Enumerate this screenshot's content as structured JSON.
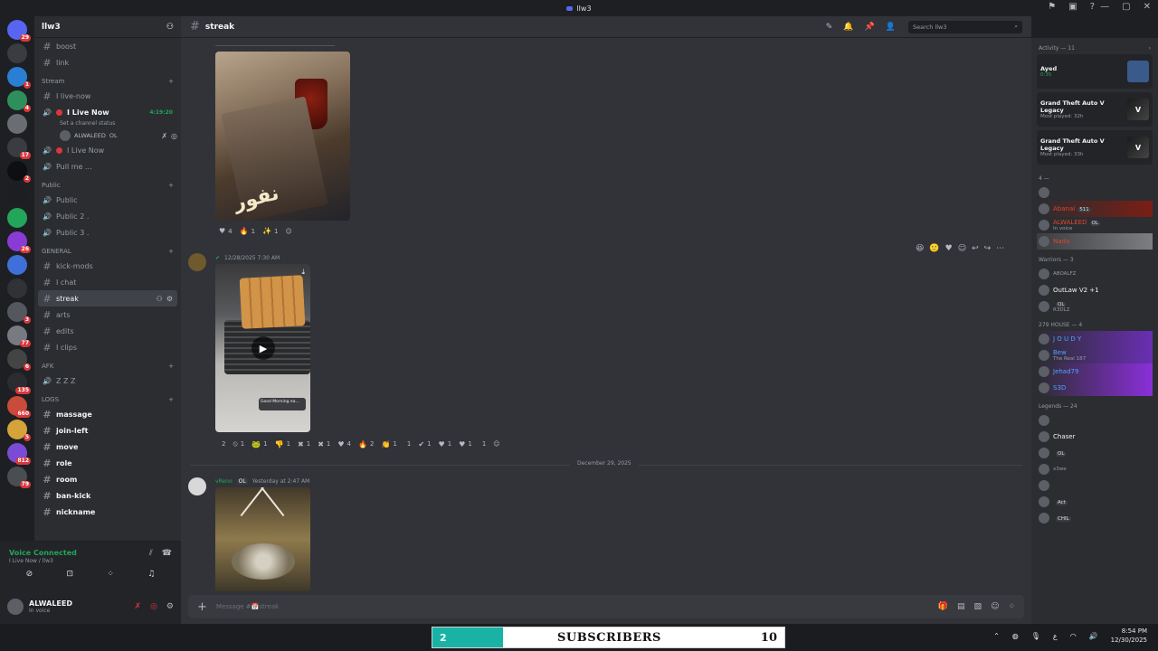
{
  "window": {
    "title": "llw3"
  },
  "guilds": [
    {
      "badge": "29"
    },
    {
      "badge": ""
    },
    {
      "badge": "1"
    },
    {
      "badge": "4"
    },
    {
      "badge": ""
    },
    {
      "badge": "17"
    },
    {
      "badge": "2"
    },
    {
      "badge": ""
    },
    {
      "badge": ""
    },
    {
      "badge": "26"
    },
    {
      "badge": ""
    },
    {
      "badge": ""
    },
    {
      "badge": "3"
    },
    {
      "badge": "77"
    },
    {
      "badge": "6"
    },
    {
      "badge": "135"
    },
    {
      "badge": "660"
    },
    {
      "badge": "5"
    },
    {
      "badge": "812"
    },
    {
      "badge": "79"
    }
  ],
  "server": {
    "name": "llw3"
  },
  "channels": {
    "top": [
      {
        "name": "boost"
      },
      {
        "name": "link"
      }
    ],
    "stream_cat": "Stream",
    "stream": {
      "live_now_text": "I live-now",
      "live_voice": "I Live Now",
      "live_time": "4:19:20",
      "status_hint": "Set a channel status",
      "voice_user": "ALWALEED",
      "voice_user_tag": "OL",
      "live_voice2": "I Live Now",
      "pull_me": "Pull me ..."
    },
    "public_cat": "Public",
    "public": [
      "Public",
      "Public 2 .",
      "Public 3 ."
    ],
    "general_cat": "GENERAL",
    "general": [
      {
        "name": "kick-mods"
      },
      {
        "name": "I chat"
      },
      {
        "name": "streak"
      },
      {
        "name": "arts"
      },
      {
        "name": "edits"
      },
      {
        "name": "I clips"
      }
    ],
    "afk_cat": "AFK",
    "afk": "Z Z Z",
    "logs_cat": "LOGS",
    "logs": [
      "massage",
      "join-left",
      "move",
      "role",
      "room",
      "ban-kick",
      "nickname"
    ]
  },
  "voice_panel": {
    "connected": "Voice Connected",
    "sub": "I Live Now / llw3"
  },
  "user_panel": {
    "name": "ALWALEED",
    "status": "In voice"
  },
  "header": {
    "channel": "streak",
    "search_placeholder": "Search llw3"
  },
  "messages": {
    "msg1_reactions": [
      {
        "emoji": "♥",
        "count": "4"
      },
      {
        "emoji": "🔥",
        "count": "1"
      },
      {
        "emoji": "✨",
        "count": "1"
      }
    ],
    "msg1_overlay_text": "نفور",
    "msg2": {
      "time": "12/28/2025 7:30 AM",
      "video_caption": "Good Morning ea..."
    },
    "msg2_reactions": [
      {
        "emoji": "",
        "count": "2"
      },
      {
        "emoji": "⦸",
        "count": "1"
      },
      {
        "emoji": "🐸",
        "count": "1"
      },
      {
        "emoji": "👎",
        "count": "1"
      },
      {
        "emoji": "✖",
        "count": "1"
      },
      {
        "emoji": "✖",
        "count": "1"
      },
      {
        "emoji": "♥",
        "count": "4"
      },
      {
        "emoji": "🔥",
        "count": "2"
      },
      {
        "emoji": "👏",
        "count": "1"
      },
      {
        "emoji": "",
        "count": "1"
      },
      {
        "emoji": "✔",
        "count": "1"
      },
      {
        "emoji": "♥",
        "count": "1"
      },
      {
        "emoji": "♥",
        "count": "1"
      },
      {
        "emoji": "",
        "count": "1"
      }
    ],
    "date_divider": "December 29, 2025",
    "msg3": {
      "author": "vReno",
      "tag": "OL",
      "time": "Yesterday at 2:47 AM"
    }
  },
  "composer": {
    "placeholder": "Message #📅streak"
  },
  "members": {
    "activity_cat": "Activity — 11",
    "activities": [
      {
        "title": "Ayed",
        "sub": "0:35",
        "sub_green": true
      },
      {
        "title": "Grand Theft Auto V Legacy",
        "sub": "Most played: 32h",
        "sub_green": false
      },
      {
        "title": "Grand Theft Auto V Legacy",
        "sub": "Most played: 33h",
        "sub_green": false
      }
    ],
    "group1_cat": "4 —",
    "group1": [
      {
        "name": "",
        "sub": ""
      },
      {
        "name": "Abanai",
        "tag": "511",
        "style": "hl-red",
        "color": "red"
      },
      {
        "name": "ALWALEED",
        "tag": "OL",
        "sub": "In voice",
        "color": "red"
      },
      {
        "name": "Nada",
        "style": "hl-grey",
        "color": "red"
      }
    ],
    "warriors_cat": "Warriors — 3",
    "warriors": [
      {
        "name": "",
        "sub": "ABOALFZ"
      },
      {
        "name": "OutLaw V2 +1",
        "sub": ""
      },
      {
        "name": "",
        "tag": "OL",
        "sub": "R3DLZ"
      }
    ],
    "house_cat": "279 HOUSE — 4",
    "house": [
      {
        "name": "J O U D Y",
        "sub": "",
        "color": "blue",
        "style": "hl-purple"
      },
      {
        "name": "Bew",
        "sub": "The Real 187",
        "color": "blue",
        "style": "hl-purple"
      },
      {
        "name": "Jehad79",
        "sub": "",
        "color": "blue",
        "style": "hl-mag"
      },
      {
        "name": "S3D",
        "sub": "",
        "color": "blue",
        "style": "hl-mag"
      }
    ],
    "legends_cat": "Legends — 24",
    "legends": [
      {
        "name": "",
        "tag": ""
      },
      {
        "name": "Chaser",
        "tag": ""
      },
      {
        "name": "",
        "tag": "OL"
      },
      {
        "name": "",
        "tag": "",
        "sub": "x3we"
      },
      {
        "name": "",
        "tag": ""
      },
      {
        "name": "",
        "tag": "Act"
      },
      {
        "name": "",
        "tag": "CHIL"
      }
    ]
  },
  "taskbar": {
    "sub_count": "2",
    "sub_label": "SUBSCRIBERS",
    "sub_goal": "10",
    "time": "8:54 PM",
    "date": "12/30/2025"
  }
}
